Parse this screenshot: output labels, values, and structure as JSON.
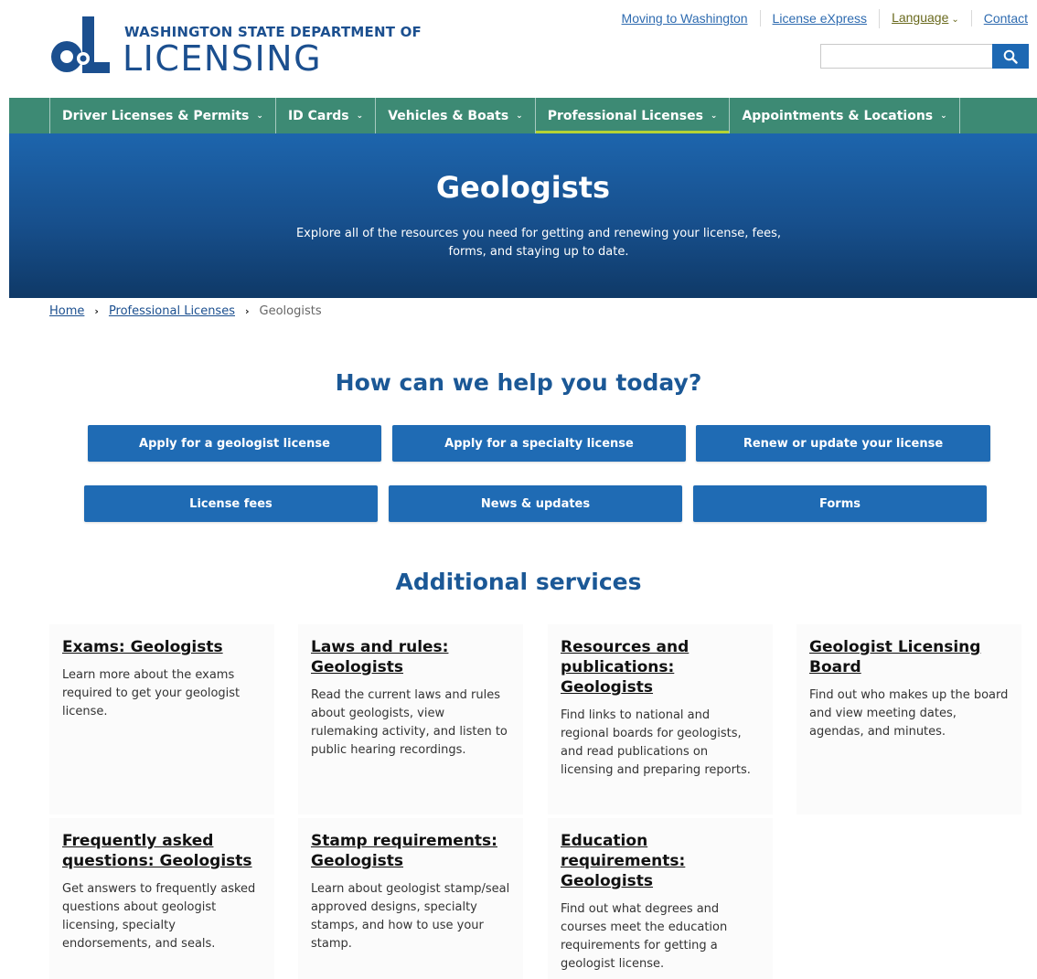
{
  "header": {
    "logo_top": "WASHINGTON STATE DEPARTMENT OF",
    "logo_main": "LICENSING",
    "utility_links": [
      {
        "label": "Moving to Washington"
      },
      {
        "label": "License eXpress"
      },
      {
        "label": "Language"
      },
      {
        "label": "Contact"
      }
    ],
    "search": {
      "placeholder": "",
      "value": ""
    }
  },
  "nav": {
    "items": [
      {
        "label": "Driver Licenses & Permits"
      },
      {
        "label": "ID Cards"
      },
      {
        "label": "Vehicles & Boats"
      },
      {
        "label": "Professional Licenses"
      },
      {
        "label": "Appointments & Locations"
      }
    ],
    "active_index": 3
  },
  "hero": {
    "title": "Geologists",
    "description": "Explore all of the resources you need for getting and renewing your license, fees, forms, and staying up to date."
  },
  "breadcrumb": {
    "items": [
      "Home",
      "Professional Licenses"
    ],
    "current": "Geologists"
  },
  "help": {
    "title": "How can we help you today?",
    "buttons": [
      "Apply for a geologist license",
      "Apply for a specialty license",
      "Renew or update your license",
      "License fees",
      "News & updates",
      "Forms"
    ]
  },
  "services": {
    "title": "Additional services",
    "cards": [
      {
        "title": "Exams: Geologists",
        "desc": "Learn more about the exams required to get your geologist license."
      },
      {
        "title": "Laws and rules: Geologists",
        "desc": "Read the current laws and rules about geologists, view rulemaking activity, and listen to public hearing recordings."
      },
      {
        "title": "Resources and publications: Geologists",
        "desc": "Find links to national and regional boards for geologists, and read publications on licensing and preparing reports."
      },
      {
        "title": "Geologist Licensing Board",
        "desc": "Find out who makes up the board and view meeting dates, agendas, and minutes."
      },
      {
        "title": "Frequently asked questions: Geologists",
        "desc": "Get answers to frequently asked questions about geologist licensing, specialty endorsements, and seals."
      },
      {
        "title": "Stamp requirements: Geologists",
        "desc": "Learn about geologist stamp/seal approved designs, specialty stamps, and how to use your stamp."
      },
      {
        "title": "Education requirements: Geologists",
        "desc": "Find out what degrees and courses meet the education requirements for getting a geologist license."
      }
    ]
  },
  "colors": {
    "brand_blue": "#1b4f8f",
    "nav_green": "#3d8a74",
    "button_blue": "#1f6bb4",
    "active_underline": "#b5d334"
  }
}
